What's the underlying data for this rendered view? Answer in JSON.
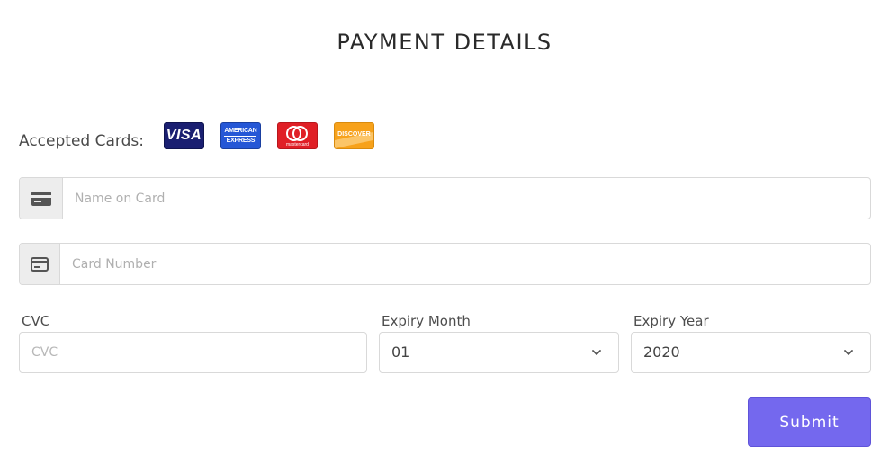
{
  "page": {
    "title": "PAYMENT DETAILS"
  },
  "accepted_cards": {
    "label": "Accepted Cards:",
    "cards": [
      {
        "name": "visa-logo",
        "text": "VISA"
      },
      {
        "name": "amex-logo",
        "text_top": "AMERICAN",
        "text_bottom": "EXPRESS"
      },
      {
        "name": "mastercard-logo",
        "text": "mastercard"
      },
      {
        "name": "discover-logo",
        "text": "DISCOVER"
      }
    ]
  },
  "form": {
    "name_on_card": {
      "placeholder": "Name on Card",
      "value": "",
      "icon": "credit-card-icon"
    },
    "card_number": {
      "placeholder": "Card Number",
      "value": "",
      "icon": "credit-card-icon"
    },
    "cvc": {
      "label": "CVC",
      "placeholder": "CVC",
      "value": ""
    },
    "expiry_month": {
      "label": "Expiry Month",
      "selected": "01"
    },
    "expiry_year": {
      "label": "Expiry Year",
      "selected": "2020"
    },
    "submit_label": "Submit"
  },
  "colors": {
    "accent": "#7468ee",
    "visa": "#1a1f71",
    "amex": "#2557d6",
    "mastercard": "#e01f26",
    "discover": "#f7a21b"
  }
}
